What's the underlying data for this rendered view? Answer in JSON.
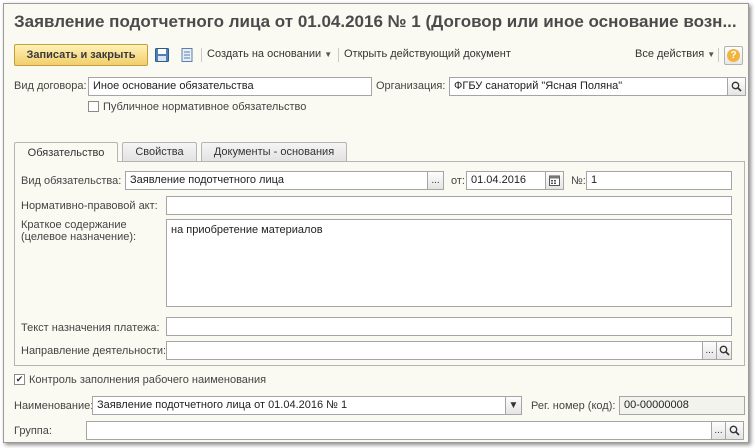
{
  "window": {
    "title": "Заявление подотчетного лица от 01.04.2016 № 1 (Договор или иное основание возн..."
  },
  "toolbar": {
    "save_close_label": "Записать и закрыть",
    "create_based_label": "Создать на основании",
    "open_document_label": "Открыть действующий документ",
    "all_actions_label": "Все действия",
    "help_label": "?"
  },
  "header": {
    "contract_type_label": "Вид договора:",
    "contract_type_value": "Иное основание обязательства",
    "organization_label": "Организация:",
    "organization_value": "ФГБУ санаторий \"Ясная Поляна\"",
    "public_obligation_label": "Публичное нормативное обязательство",
    "public_obligation_checked": false
  },
  "tabs": [
    {
      "label": "Обязательство",
      "active": true
    },
    {
      "label": "Свойства",
      "active": false
    },
    {
      "label": "Документы - основания",
      "active": false
    }
  ],
  "obligation": {
    "type_label": "Вид обязательства:",
    "type_value": "Заявление подотчетного лица",
    "type_button": "...",
    "date_label": "от:",
    "date_value": "01.04.2016",
    "number_label": "№:",
    "number_value": "1",
    "legal_act_label": "Нормативно-правовой акт:",
    "legal_act_value": "",
    "summary_label_1": "Краткое содержание",
    "summary_label_2": "(целевое назначение):",
    "summary_value": "на приобретение материалов",
    "payment_text_label": "Текст назначения платежа:",
    "payment_text_value": "",
    "activity_label": "Направление деятельности:",
    "activity_value": "",
    "activity_button": "..."
  },
  "footer": {
    "control_label": "Контроль заполнения рабочего наименования",
    "control_checked": true,
    "name_label": "Наименование:",
    "name_value": "Заявление подотчетного лица от 01.04.2016 № 1",
    "reg_number_label": "Рег. номер (код):",
    "reg_number_value": "00-00000008",
    "group_label": "Группа:",
    "group_value": "",
    "group_button": "..."
  },
  "colors": {
    "primary_button": "#f1cf6a",
    "window_bg": "#fafaf3",
    "title_text": "#4b4b4b"
  }
}
